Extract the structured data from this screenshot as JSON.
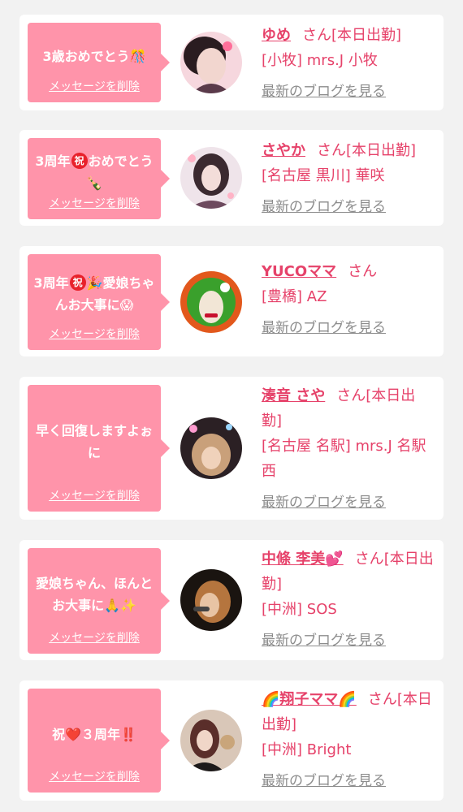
{
  "delete_label": "メッセージを削除",
  "blog_label": "最新のブログを見る",
  "san_label": "さん",
  "cards": [
    {
      "message": "3歳おめでとう🎊",
      "name": "ゆめ",
      "status": "[本日出勤]",
      "shop": "[小牧] mrs.J 小牧"
    },
    {
      "message_parts": [
        "3周年",
        "祝",
        "おめでとう🍾"
      ],
      "name": "さやか",
      "status": "[本日出勤]",
      "shop": "[名古屋 黒川] 華咲"
    },
    {
      "message_parts": [
        "3周年",
        "祝",
        "🎉愛娘ちゃんお大事に😱"
      ],
      "name": "YUCOママ",
      "status": "",
      "shop": "[豊橋] AZ"
    },
    {
      "message": "早く回復しますよぉに",
      "name": "湊音 さや",
      "status": "[本日出勤]",
      "shop": "[名古屋 名駅] mrs.J 名駅西"
    },
    {
      "message": "愛娘ちゃん、ほんとお大事に🙏✨",
      "name": "中條 李美💕",
      "status": "[本日出勤]",
      "shop": "[中洲] SOS"
    },
    {
      "message": "祝❤️３周年‼️",
      "name": "🌈翔子ママ🌈",
      "status": "[本日出勤]",
      "shop": "[中洲] Bright"
    }
  ]
}
